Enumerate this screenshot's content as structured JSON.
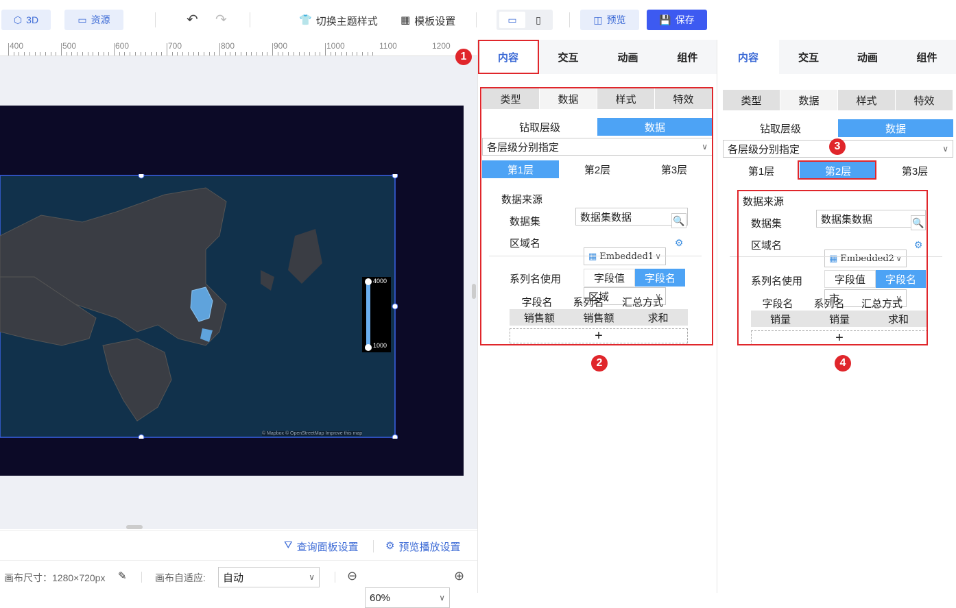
{
  "toolbar": {
    "btn_3d": "3D",
    "btn_resource": "资源",
    "switch_theme": "切换主题样式",
    "template_settings": "模板设置",
    "preview": "预览",
    "save": "保存"
  },
  "ruler": {
    "labels": [
      "400",
      "500",
      "600",
      "700",
      "800",
      "900",
      "1000",
      "1100",
      "1200"
    ]
  },
  "map": {
    "legend_max": "4000",
    "legend_min": "1000",
    "attribution": "© Mapbox © OpenStreetMap Improve this map"
  },
  "bottom": {
    "query_panel": "查询面板设置",
    "preview_play": "预览播放设置",
    "canvas_size": "画布尺寸：1280×720px",
    "canvas_fit_label": "画布自适应:",
    "canvas_fit_value": "自动",
    "zoom": "60%"
  },
  "left_panel": {
    "tabs": [
      "内容",
      "交互",
      "动画",
      "组件"
    ],
    "subtabs": [
      "类型",
      "数据",
      "样式",
      "特效"
    ],
    "toggle": [
      "钻取层级",
      "数据"
    ],
    "mode": "各层级分别指定",
    "levels": [
      "第1层",
      "第2层",
      "第3层"
    ],
    "source_label": "数据来源",
    "source_value": "数据集数据",
    "dataset_label": "数据集",
    "dataset_value": "Embedded1",
    "region_label": "区域名",
    "region_value": "区域",
    "series_label": "系列名使用",
    "series_opts": [
      "字段值",
      "字段名"
    ],
    "table_headers": [
      "字段名",
      "系列名",
      "汇总方式"
    ],
    "table_row": [
      "销售额",
      "销售额",
      "求和"
    ],
    "add": "+"
  },
  "right_panel": {
    "tabs": [
      "内容",
      "交互",
      "动画",
      "组件"
    ],
    "subtabs": [
      "类型",
      "数据",
      "样式",
      "特效"
    ],
    "toggle": [
      "钻取层级",
      "数据"
    ],
    "mode": "各层级分别指定",
    "levels": [
      "第1层",
      "第2层",
      "第3层"
    ],
    "source_label": "数据来源",
    "source_value": "数据集数据",
    "dataset_label": "数据集",
    "dataset_value": "Embedded2",
    "region_label": "区域名",
    "region_value": "市",
    "series_label": "系列名使用",
    "series_opts": [
      "字段值",
      "字段名"
    ],
    "table_headers": [
      "字段名",
      "系列名",
      "汇总方式"
    ],
    "table_row": [
      "销量",
      "销量",
      "求和"
    ],
    "add": "+"
  },
  "badges": [
    "1",
    "2",
    "3",
    "4"
  ],
  "colors": {
    "accent": "#3d6bd6",
    "highlight": "#4da3f5",
    "annotation": "#e0262b",
    "map_bg": "#0c0a27"
  }
}
